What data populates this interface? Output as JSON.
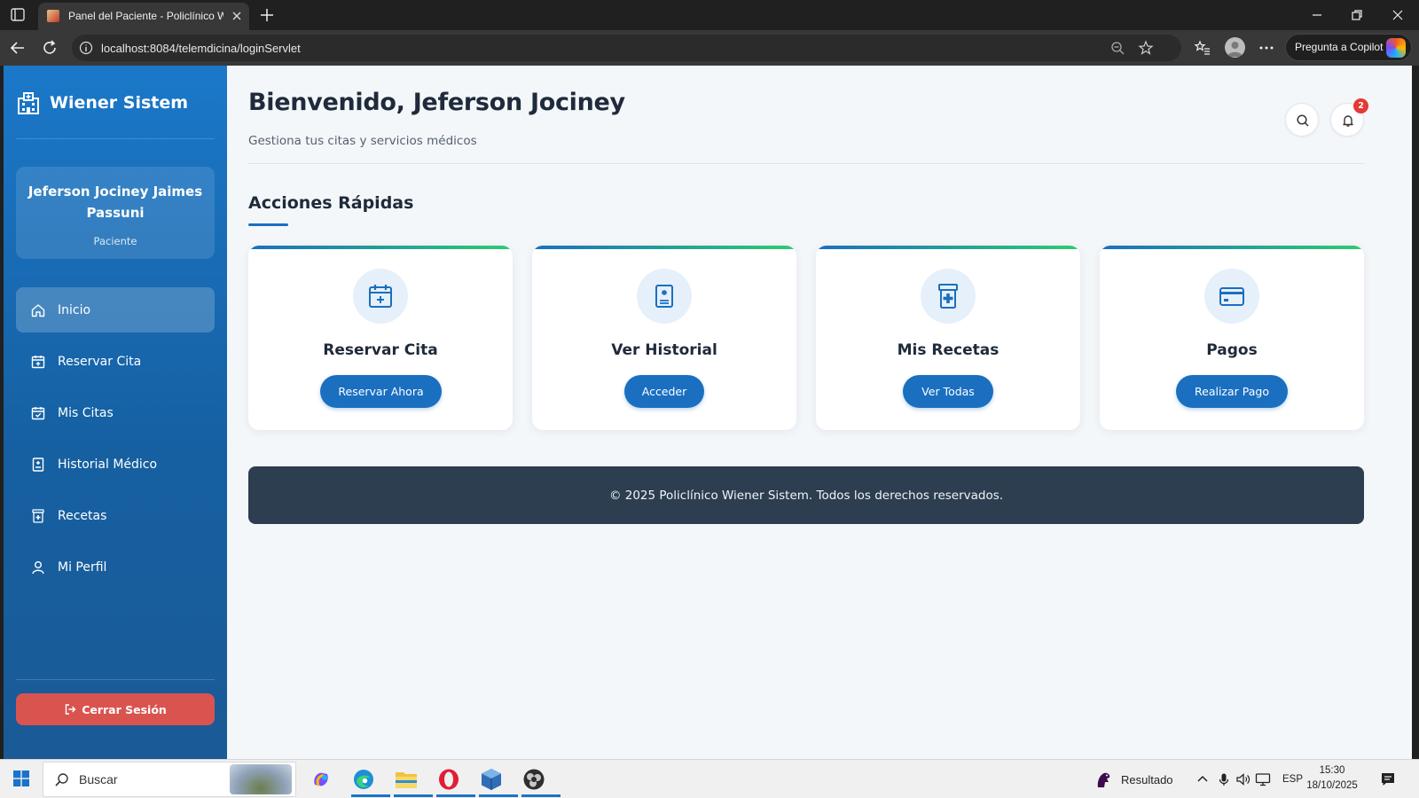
{
  "browser": {
    "tab_title": "Panel del Paciente - Policlínico Wiener Sistem",
    "url": "localhost:8084/telemdicina/loginServlet",
    "copilot_label": "Pregunta a Copilot"
  },
  "sidebar": {
    "brand": "Wiener Sistem",
    "user_name": "Jeferson Jociney Jaimes Passuni",
    "user_role": "Paciente",
    "items": [
      {
        "label": "Inicio",
        "icon": "home-icon",
        "active": true
      },
      {
        "label": "Reservar Cita",
        "icon": "calendar-plus-icon"
      },
      {
        "label": "Mis Citas",
        "icon": "calendar-check-icon"
      },
      {
        "label": "Historial Médico",
        "icon": "medical-file-icon"
      },
      {
        "label": "Recetas",
        "icon": "prescription-icon"
      },
      {
        "label": "Mi Perfil",
        "icon": "user-icon"
      }
    ],
    "logout_label": "Cerrar Sesión"
  },
  "header": {
    "title": "Bienvenido, Jeferson Jociney",
    "subtitle": "Gestiona tus citas y servicios médicos",
    "notification_count": "2"
  },
  "quick_actions": {
    "title": "Acciones Rápidas",
    "cards": [
      {
        "title": "Reservar Cita",
        "button": "Reservar Ahora",
        "icon": "calendar-plus-icon"
      },
      {
        "title": "Ver Historial",
        "button": "Acceder",
        "icon": "medical-file-icon"
      },
      {
        "title": "Mis Recetas",
        "button": "Ver Todas",
        "icon": "prescription-icon"
      },
      {
        "title": "Pagos",
        "button": "Realizar Pago",
        "icon": "credit-card-icon"
      }
    ]
  },
  "footer": {
    "text": "© 2025 Policlínico Wiener Sistem. Todos los derechos reservados."
  },
  "taskbar": {
    "search_label": "Buscar",
    "weather_label": "Resultado",
    "language": "ESP",
    "time": "15:30",
    "date": "18/10/2025"
  },
  "colors": {
    "sidebar": "#1b78c9",
    "accent": "#1a6fc0",
    "logout": "#d9534f",
    "footer": "#2c3e50",
    "badge": "#e53935",
    "card_gradient_end": "#2ecc71"
  }
}
